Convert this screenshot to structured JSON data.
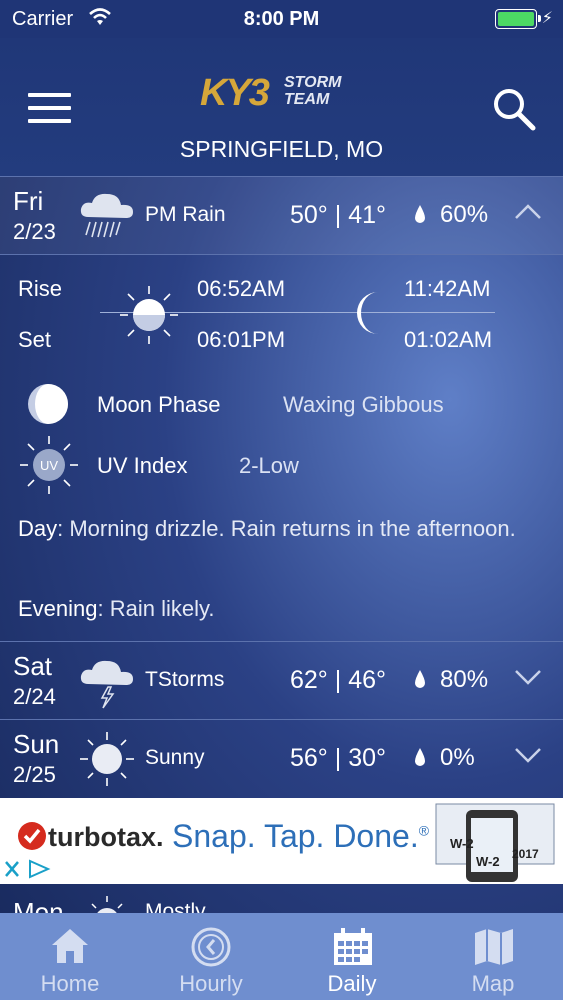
{
  "status_bar": {
    "carrier": "Carrier",
    "time": "8:00 PM"
  },
  "header": {
    "logo_main": "KY3",
    "logo_sub_1": "STORM",
    "logo_sub_2": "TEAM",
    "city": "SPRINGFIELD, MO"
  },
  "days": [
    {
      "dow": "Fri",
      "date": "2/23",
      "condition": "PM Rain",
      "temps": "50° | 41°",
      "precip": "60%",
      "icon": "rain-cloud-icon",
      "expanded": true
    },
    {
      "dow": "Sat",
      "date": "2/24",
      "condition": "TStorms",
      "temps": "62° | 46°",
      "precip": "80%",
      "icon": "thunderstorm-icon",
      "expanded": false
    },
    {
      "dow": "Sun",
      "date": "2/25",
      "condition": "Sunny",
      "temps": "56° | 30°",
      "precip": "0%",
      "icon": "sun-icon",
      "expanded": false
    },
    {
      "dow": "Mon",
      "condition": "Mostly",
      "icon": "partly-sunny-icon"
    }
  ],
  "detail": {
    "rise_label": "Rise",
    "set_label": "Set",
    "sunrise": "06:52AM",
    "sunset": "06:01PM",
    "moonrise": "11:42AM",
    "moonset": "01:02AM",
    "moon_phase_label": "Moon Phase",
    "moon_phase_value": "Waxing Gibbous",
    "uv_label": "UV Index",
    "uv_value": "2-Low",
    "uv_badge": "UV",
    "day_label": "Day",
    "day_text": ": Morning drizzle.  Rain returns in the afternoon.",
    "evening_label": "Evening",
    "evening_text": ": Rain likely."
  },
  "ad": {
    "brand": "turbotax.",
    "tagline": "Snap. Tap. Done.",
    "mark": "®",
    "form_1": "W-2",
    "form_2": "W-2",
    "year": "2017"
  },
  "tabs": [
    {
      "label": "Home",
      "icon": "home-icon",
      "active": false
    },
    {
      "label": "Hourly",
      "icon": "clock-icon",
      "active": false
    },
    {
      "label": "Daily",
      "icon": "calendar-icon",
      "active": true
    },
    {
      "label": "Map",
      "icon": "map-icon",
      "active": false
    }
  ],
  "colors": {
    "header": "#203778",
    "tabbar": "#6f8ecf",
    "accent_gold": "#d6a73a",
    "turbotax_blue": "#2d6fb8"
  }
}
